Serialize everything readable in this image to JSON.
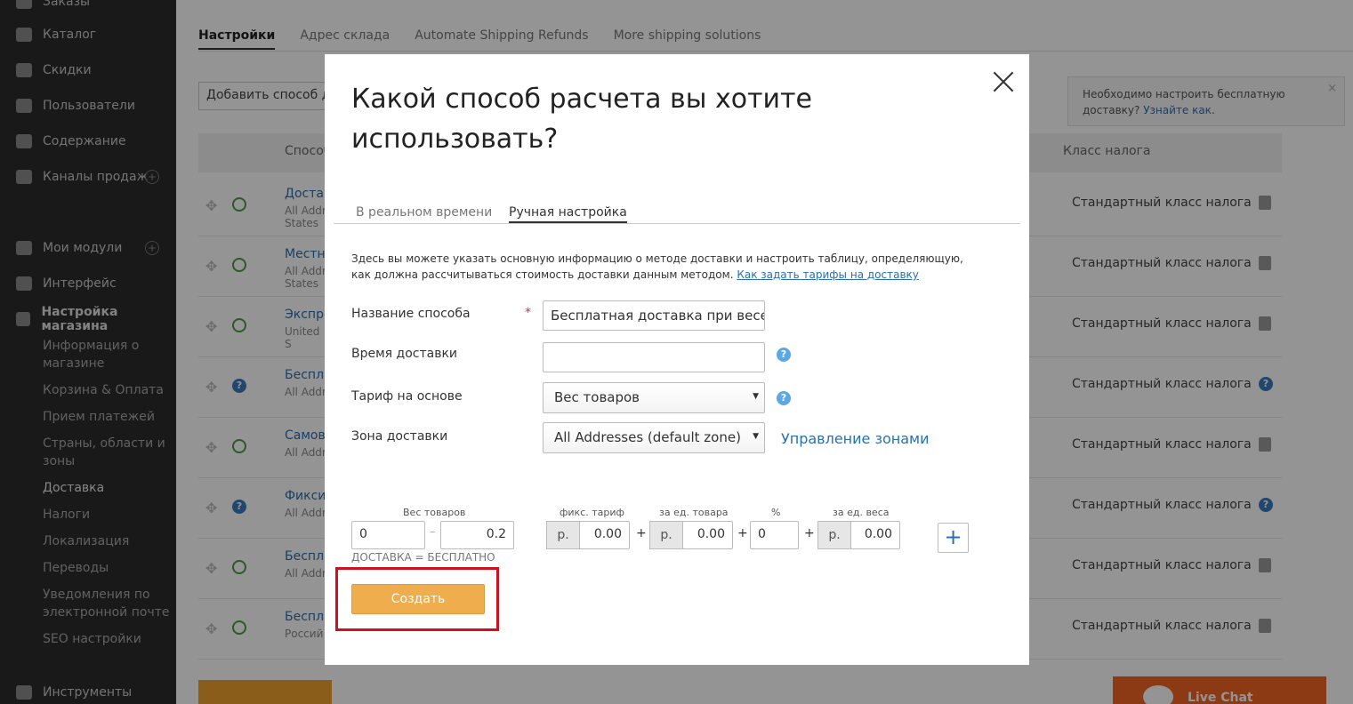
{
  "sidebar": {
    "top_partial": "Заказы",
    "items": [
      {
        "label": "Каталог",
        "icon": "tag-icon"
      },
      {
        "label": "Скидки",
        "icon": "discount-icon"
      },
      {
        "label": "Пользователи",
        "icon": "users-icon"
      },
      {
        "label": "Содержание",
        "icon": "content-icon"
      },
      {
        "label": "Каналы продаж",
        "icon": "channels-icon"
      },
      {
        "label": "Мои модули",
        "icon": "puzzle-icon"
      },
      {
        "label": "Интерфейс",
        "icon": "interface-icon"
      },
      {
        "label": "Настройка магазина",
        "icon": "settings-icon"
      },
      {
        "label": "Инструменты",
        "icon": "tools-icon"
      }
    ],
    "subitems": [
      "Информация о магазине",
      "Корзина & Оплата",
      "Прием платежей",
      "Страны, области и зоны",
      "Доставка",
      "Налоги",
      "Локализация",
      "Переводы",
      "Уведомления по электронной почте",
      "SEO настройки"
    ]
  },
  "background": {
    "tabs": [
      "Настройки",
      "Адрес склада",
      "Automate Shipping Refunds",
      "More shipping solutions"
    ],
    "add_method": "Добавить способ доставки",
    "note": {
      "text": "Необходимо настроить бесплатную доставку?",
      "link": "Узнайте как",
      "suffix": "."
    },
    "columns": [
      "Способ",
      "Класс налога"
    ],
    "rows": [
      {
        "name": "Достав",
        "sub": "All Addr States",
        "tax": "Стандартный класс налога",
        "status": "power"
      },
      {
        "name": "Местна",
        "sub": "All Addr States",
        "tax": "Стандартный класс налога",
        "status": "power"
      },
      {
        "name": "Экспре",
        "sub": "United S",
        "tax": "Стандартный класс налога",
        "status": "power"
      },
      {
        "name": "Беспла",
        "sub": "All Addr",
        "tax": "Стандартный класс налога",
        "status": "help"
      },
      {
        "name": "Самов",
        "sub": "All Addr",
        "tax": "Стандартный класс налога",
        "status": "power"
      },
      {
        "name": "Фикси",
        "sub": "All Addr",
        "tax": "Стандартный класс налога",
        "status": "help"
      },
      {
        "name": "Беспла",
        "sub": "All Addr",
        "tax": "Стандартный класс налога",
        "status": "power"
      },
      {
        "name": "Беспла",
        "sub": "Россий",
        "tax": "Стандартный класс налога",
        "status": "power"
      }
    ],
    "livechat": "Live Chat"
  },
  "modal": {
    "title": "Какой способ расчета вы хотите использовать?",
    "tabs": [
      "В реальном времени",
      "Ручная настройка"
    ],
    "description": "Здесь вы можете указать основную информацию о методе доставки и настроить таблицу, определяющую, как должна рассчитываться стоимость доставки данным методом.",
    "description_link": "Как задать тарифы на доставку",
    "fields": {
      "name_label": "Название способа",
      "name_value": "Бесплатная доставка при весе",
      "time_label": "Время доставки",
      "time_value": "",
      "rate_label": "Тариф на основе",
      "rate_value": "Вес товаров",
      "zone_label": "Зона доставки",
      "zone_value": "All Addresses (default zone)",
      "zone_link": "Управление зонами"
    },
    "rates": {
      "weight_label": "Вес товаров",
      "weight_from": "0",
      "weight_to": "0.2",
      "fixed_label": "фикс. тариф",
      "per_item_label": "за ед. товара",
      "percent_label": "%",
      "per_weight_label": "за ед. веса",
      "currency": "р.",
      "fixed_value": "0.00",
      "per_item_value": "0.00",
      "percent_value": "0",
      "per_weight_value": "0.00",
      "free_note": "ДОСТАВКА = БЕСПЛАТНО"
    },
    "create_button": "Создать"
  }
}
